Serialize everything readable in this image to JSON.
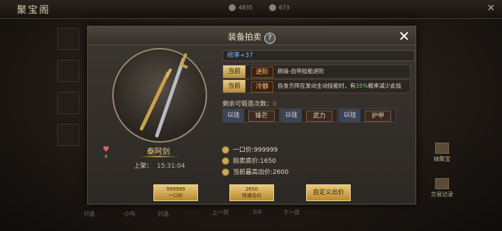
{
  "topbar": {
    "logo": "聚宝阁",
    "currency_a": "4835",
    "currency_b": "673"
  },
  "right_nav": {
    "item1": "抽聚宝",
    "item2": "交易记录"
  },
  "bottom_bar": {
    "l1": "只选",
    "l2": "小鸟",
    "l3": "只选",
    "prev": "上一页",
    "page": "3/4",
    "next": "下一页"
  },
  "modal": {
    "title": "装备拍卖",
    "help": "?",
    "close": "✕"
  },
  "item": {
    "name": "泰阿剑",
    "likes": "4",
    "shelf_label": "上架：",
    "shelf_time": "15:31:04"
  },
  "attribute": "统率+37",
  "skills": [
    {
      "current_label": "当前",
      "skill": "进阶",
      "desc_pre": "刷缘-自带技能进阶"
    },
    {
      "current_label": "当前",
      "skill": "冷静",
      "desc_pre": "自身方阵在发动主动技能时，有",
      "pct": "35%",
      "desc_post": "概率减少此技"
    }
  ],
  "forge": {
    "label": "剩余可锻造次数：",
    "count": "0"
  },
  "previous": [
    {
      "label": "以往",
      "skill": "锋芒"
    },
    {
      "label": "以往",
      "skill": "武力"
    },
    {
      "label": "以往",
      "skill": "护甲"
    }
  ],
  "prices": {
    "buyout": "一口价:999999",
    "reserve": "拍卖底价:1650",
    "highest": "当前最高出价:2600"
  },
  "buttons": [
    {
      "amount": "999999",
      "label": "一口价"
    },
    {
      "amount": "2650",
      "label": "快速出价"
    },
    {
      "amount": "",
      "label": "自定义出价"
    }
  ]
}
